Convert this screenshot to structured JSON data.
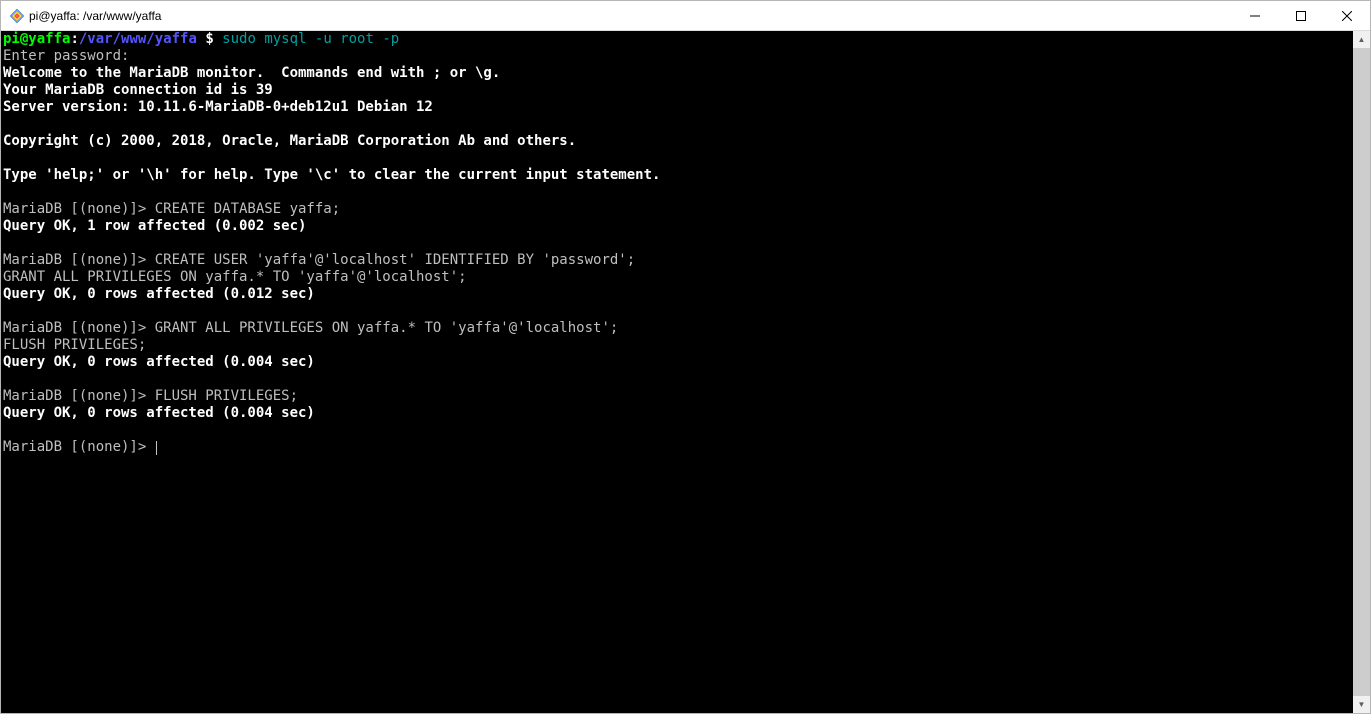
{
  "titlebar": {
    "title": "pi@yaffa: /var/www/yaffa"
  },
  "prompt": {
    "user_host": "pi@yaffa",
    "sep": ":",
    "path": "/var/www/yaffa",
    "dollar": " $",
    "command": " sudo mysql -u root -p"
  },
  "term": {
    "l1": "Enter password:",
    "l2": "Welcome to the MariaDB monitor.  Commands end with ; or \\g.",
    "l3": "Your MariaDB connection id is 39",
    "l4": "Server version: 10.11.6-MariaDB-0+deb12u1 Debian 12",
    "l5": "",
    "l6": "Copyright (c) 2000, 2018, Oracle, MariaDB Corporation Ab and others.",
    "l7": "",
    "l8": "Type 'help;' or '\\h' for help. Type '\\c' to clear the current input statement.",
    "l9": "",
    "p1": "MariaDB [(none)]> ",
    "c1": "CREATE DATABASE yaffa;",
    "r1": "Query OK, 1 row affected (0.002 sec)",
    "blank1": "",
    "p2": "MariaDB [(none)]> ",
    "c2": "CREATE USER 'yaffa'@'localhost' IDENTIFIED BY 'password';",
    "c2b": "GRANT ALL PRIVILEGES ON yaffa.* TO 'yaffa'@'localhost';",
    "r2": "Query OK, 0 rows affected (0.012 sec)",
    "blank2": "",
    "p3": "MariaDB [(none)]> ",
    "c3": "GRANT ALL PRIVILEGES ON yaffa.* TO 'yaffa'@'localhost';",
    "c3b": "FLUSH PRIVILEGES;",
    "r3": "Query OK, 0 rows affected (0.004 sec)",
    "blank3": "",
    "p4": "MariaDB [(none)]> ",
    "c4": "FLUSH PRIVILEGES;",
    "r4": "Query OK, 0 rows affected (0.004 sec)",
    "blank4": "",
    "p5": "MariaDB [(none)]> "
  }
}
